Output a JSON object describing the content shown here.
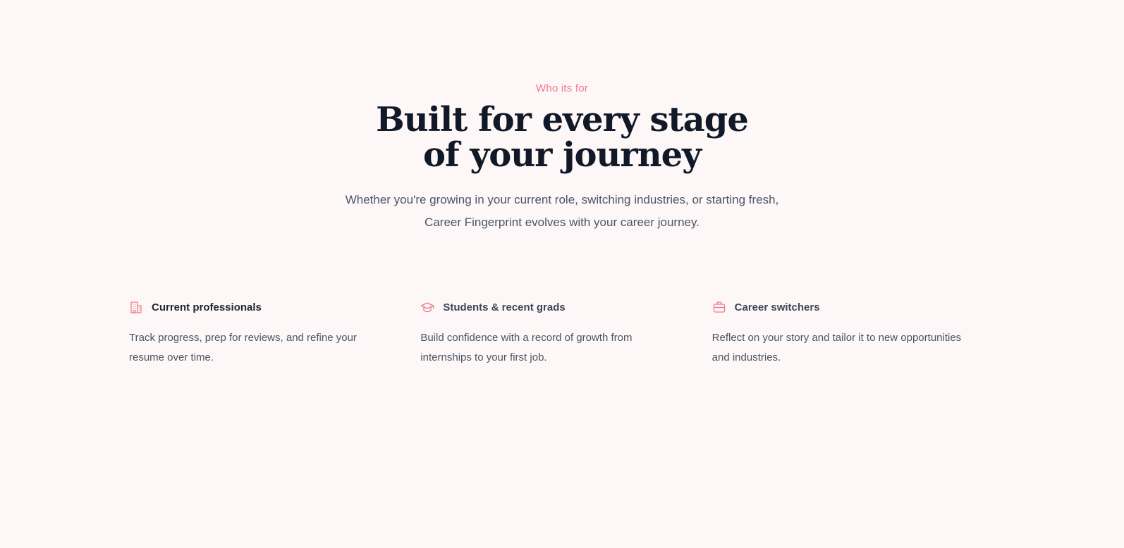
{
  "section": {
    "eyebrow": "Who its for",
    "headline_line1": "Built for every stage",
    "headline_line2": "of your journey",
    "subtitle_line1": "Whether you're growing in your current role, switching industries, or starting fresh,",
    "subtitle_line2": "Career Fingerprint evolves with your career journey."
  },
  "colors": {
    "accent": "#f0768b",
    "background": "#fdf8f7",
    "heading": "#111827",
    "body": "#4a5366"
  },
  "cards": [
    {
      "icon": "building-icon",
      "title": "Current professionals",
      "description": "Track progress, prep for reviews, and refine your resume over time."
    },
    {
      "icon": "graduation-cap-icon",
      "title": "Students & recent grads",
      "description": "Build confidence with a record of growth from internships to your first job."
    },
    {
      "icon": "briefcase-icon",
      "title": "Career switchers",
      "description": "Reflect on your story and tailor it to new opportunities and industries."
    }
  ]
}
